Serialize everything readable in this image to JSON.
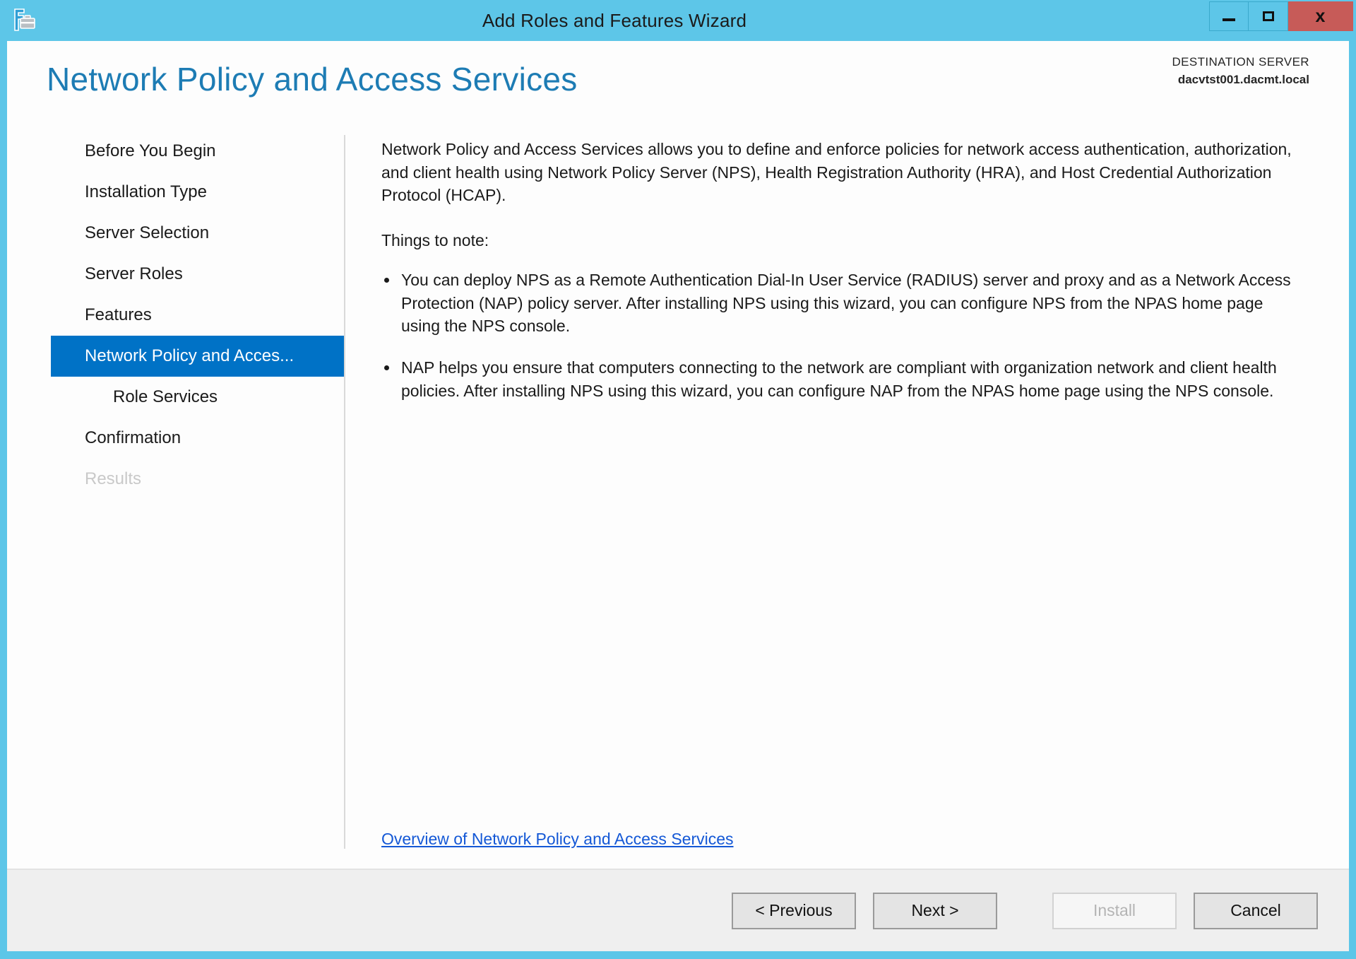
{
  "window": {
    "title": "Add Roles and Features Wizard",
    "icon": "roles-features-wizard-icon",
    "controls": {
      "minimize": "–",
      "maximize": "□",
      "close": "x"
    },
    "accent_color": "#5dc6e8",
    "close_color": "#c75b58"
  },
  "header": {
    "page_title": "Network Policy and Access Services",
    "destination_label": "DESTINATION SERVER",
    "destination_server": "dacvtst001.dacmt.local",
    "title_color": "#1d7cb4"
  },
  "sidebar": {
    "selected_color": "#0072c6",
    "items": [
      {
        "label": "Before You Begin",
        "state": "normal",
        "sub": false
      },
      {
        "label": "Installation Type",
        "state": "normal",
        "sub": false
      },
      {
        "label": "Server Selection",
        "state": "normal",
        "sub": false
      },
      {
        "label": "Server Roles",
        "state": "normal",
        "sub": false
      },
      {
        "label": "Features",
        "state": "normal",
        "sub": false
      },
      {
        "label": "Network Policy and Acces...",
        "state": "selected",
        "sub": false
      },
      {
        "label": "Role Services",
        "state": "normal",
        "sub": true
      },
      {
        "label": "Confirmation",
        "state": "normal",
        "sub": false
      },
      {
        "label": "Results",
        "state": "disabled",
        "sub": false
      }
    ]
  },
  "content": {
    "intro": "Network Policy and Access Services allows you to define and enforce policies for network access authentication, authorization, and client health using Network Policy Server (NPS), Health Registration Authority (HRA), and Host Credential Authorization Protocol (HCAP).",
    "notes_label": "Things to note:",
    "notes": [
      "You can deploy NPS as a Remote Authentication Dial-In User Service (RADIUS) server and proxy and as a Network Access Protection (NAP) policy server. After installing NPS using this wizard, you can configure NPS from the NPAS home page using the NPS console.",
      "NAP helps you ensure that computers connecting to the network are compliant with organization network and client health policies. After installing NPS using this wizard, you can configure NAP from the NPAS home page using the NPS console."
    ],
    "overview_link": "Overview of Network Policy and Access Services",
    "link_color": "#1458d6"
  },
  "footer": {
    "previous": "< Previous",
    "next": "Next >",
    "install": "Install",
    "cancel": "Cancel"
  }
}
